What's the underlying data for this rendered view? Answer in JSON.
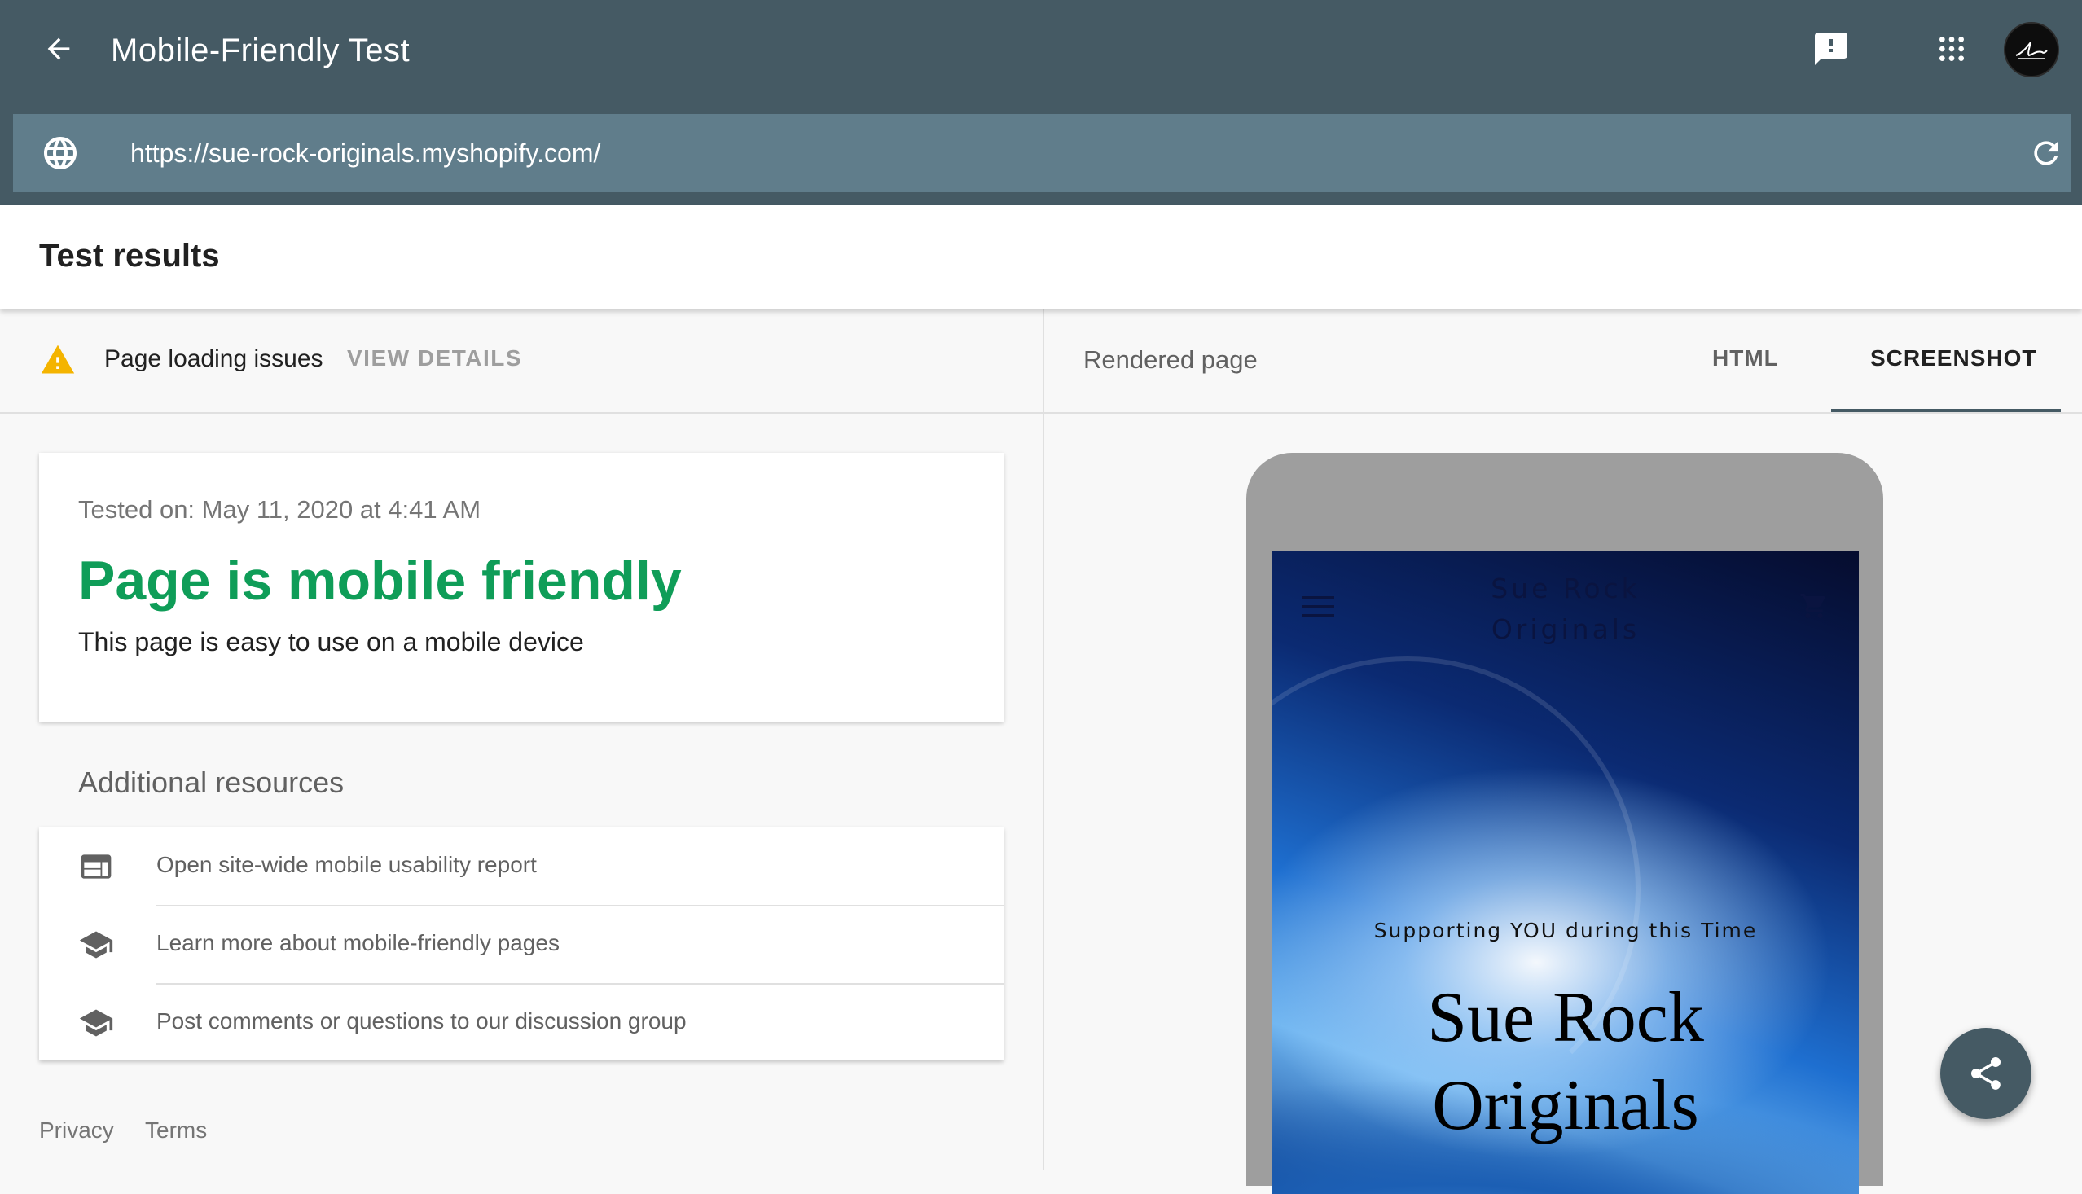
{
  "app": {
    "title": "Mobile-Friendly Test",
    "back_icon": "arrow-back-icon",
    "feedback_icon": "feedback-icon",
    "apps_icon": "apps-grid-icon",
    "avatar_icon": "account-avatar"
  },
  "url_bar": {
    "value": "https://sue-rock-originals.myshopify.com/",
    "globe_icon": "globe-icon",
    "refresh_icon": "refresh-icon"
  },
  "results": {
    "title": "Test results"
  },
  "issues": {
    "text": "Page loading issues",
    "action": "VIEW DETAILS",
    "icon": "warning-icon",
    "icon_color": "#f4b400"
  },
  "summary": {
    "tested_on": "Tested on: May 11, 2020 at 4:41 AM",
    "verdict": "Page is mobile friendly",
    "verdict_color": "#0f9d58",
    "description": "This page is easy to use on a mobile device"
  },
  "resources": {
    "title": "Additional resources",
    "items": [
      {
        "label": "Open site-wide mobile usability report",
        "icon": "web-report-icon"
      },
      {
        "label": "Learn more about mobile-friendly pages",
        "icon": "school-icon"
      },
      {
        "label": "Post comments or questions to our discussion group",
        "icon": "school-icon"
      }
    ]
  },
  "footer": {
    "privacy": "Privacy",
    "terms": "Terms"
  },
  "rendered": {
    "label": "Rendered page",
    "tabs": [
      {
        "label": "HTML",
        "selected": false
      },
      {
        "label": "SCREENSHOT",
        "selected": true
      }
    ]
  },
  "site_preview": {
    "header_title": "Sue Rock\nOriginals",
    "tagline": "Supporting YOU during this Time",
    "hero_title": "Sue Rock\nOriginals",
    "menu_icon": "hamburger-menu-icon",
    "cart_icon": "shopping-cart-icon"
  },
  "share": {
    "icon": "share-icon"
  }
}
